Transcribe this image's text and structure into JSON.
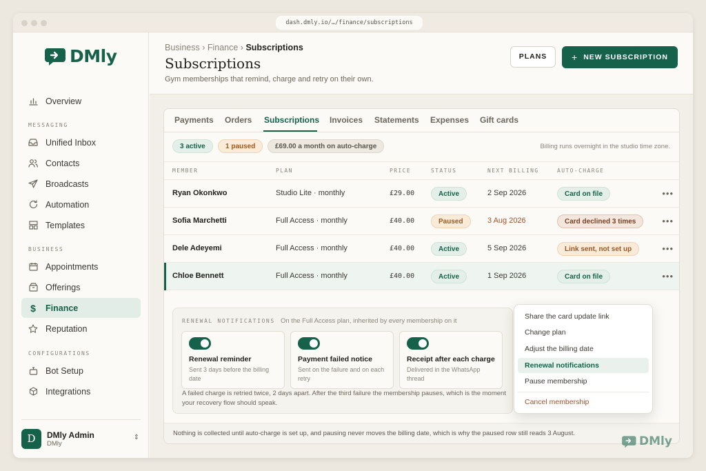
{
  "browser": {
    "url": "dash.dmly.io/…/finance/subscriptions"
  },
  "brand": {
    "name": "DMly",
    "accent": "#15614a"
  },
  "sidebar": {
    "overview": "Overview",
    "sections": {
      "messaging": "MESSAGING",
      "business": "BUSINESS",
      "configurations": "CONFIGURATIONS"
    },
    "items": {
      "unified_inbox": "Unified Inbox",
      "contacts": "Contacts",
      "broadcasts": "Broadcasts",
      "automation": "Automation",
      "templates": "Templates",
      "appointments": "Appointments",
      "offerings": "Offerings",
      "finance": "Finance",
      "reputation": "Reputation",
      "bot_setup": "Bot Setup",
      "integrations": "Integrations"
    },
    "user": {
      "initial": "D",
      "name": "DMly Admin",
      "org": "DMly"
    }
  },
  "header": {
    "breadcrumb": {
      "a": "Business ›",
      "b": "Finance ›",
      "current": "Subscriptions"
    },
    "title": "Subscriptions",
    "subtitle": "Gym memberships that remind, charge and retry on their own.",
    "plans_label": "PLANS",
    "new_label": "NEW SUBSCRIPTION"
  },
  "tabs": [
    "Payments",
    "Orders",
    "Subscriptions",
    "Invoices",
    "Statements",
    "Expenses",
    "Gift cards"
  ],
  "summary": {
    "active": "3 active",
    "paused": "1 paused",
    "monthly": "£69.00 a month on auto-charge",
    "note": "Billing runs overnight in the studio time zone."
  },
  "table": {
    "headers": {
      "member": "MEMBER",
      "plan": "PLAN",
      "price": "PRICE",
      "status": "STATUS",
      "next": "NEXT BILLING",
      "auto": "AUTO-CHARGE"
    },
    "rows": [
      {
        "member": "Ryan Okonkwo",
        "plan": "Studio Lite · monthly",
        "price": "£29.00",
        "status": "Active",
        "next": "2 Sep 2026",
        "auto": "Card on file"
      },
      {
        "member": "Sofia Marchetti",
        "plan": "Full Access · monthly",
        "price": "£40.00",
        "status": "Paused",
        "next": "3 Aug 2026",
        "auto": "Card declined 3 times"
      },
      {
        "member": "Dele Adeyemi",
        "plan": "Full Access · monthly",
        "price": "£40.00",
        "status": "Active",
        "next": "5 Sep 2026",
        "auto": "Link sent, not set up"
      },
      {
        "member": "Chloe Bennett",
        "plan": "Full Access · monthly",
        "price": "£40.00",
        "status": "Active",
        "next": "1 Sep 2026",
        "auto": "Card on file"
      }
    ]
  },
  "renewal": {
    "heading": "RENEWAL NOTIFICATIONS",
    "subheading": "On the Full Access plan, inherited by every membership on it",
    "cards": [
      {
        "title": "Renewal reminder",
        "desc": "Sent 3 days before the billing date",
        "enabled": true
      },
      {
        "title": "Payment failed notice",
        "desc": "Sent on the failure and on each retry",
        "enabled": true
      },
      {
        "title": "Receipt after each charge",
        "desc": "Delivered in the WhatsApp thread",
        "enabled": true
      }
    ],
    "footnote": "A failed charge is retried twice, 2 days apart. After the third failure the membership pauses, which is the moment your recovery flow should speak."
  },
  "menu": {
    "items": [
      "Share the card update link",
      "Change plan",
      "Adjust the billing date",
      "Renewal notifications",
      "Pause membership"
    ],
    "highlighted": "Renewal notifications",
    "danger": "Cancel membership"
  },
  "footer_note": "Nothing is collected until auto-charge is set up, and pausing never moves the billing date, which is why the paused row still reads 3 August.",
  "watermark": "DMly"
}
